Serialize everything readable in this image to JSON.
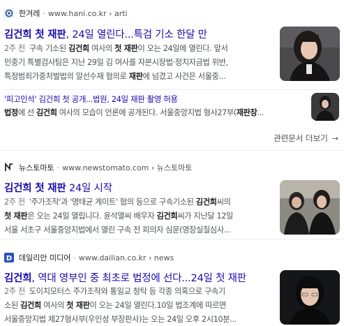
{
  "results": [
    {
      "source": "한겨레",
      "url": "www.hani.co.kr › arti",
      "favicon_color": "#1c4e8c",
      "title_pre": "김건희 첫 재판",
      "title_post": ", 24일 열린다...특검 기소 한달 만",
      "snippet": [
        {
          "date": "2주 전",
          "segs": [
            "구속 기소된 ",
            "**김건희",
            " 여사의 ",
            "**첫 재판",
            "이 오는 24일에 열린다. 앞서"
          ]
        },
        {
          "segs": [
            "민중기 특별검사팀은 지난 29일 김 여사를 자본시장법·정치자금법 위반,"
          ]
        },
        {
          "segs": [
            "특정범죄가중처벌법의 알선수재 혐의로 ",
            "**재판",
            "에 넘겼고 사건은 서울중..."
          ]
        }
      ]
    },
    {
      "source": "뉴스토마토",
      "url": "www.newstomato.com › 뉴스토마토",
      "favicon_color": "#222222",
      "title_pre": "김건희 첫 재판",
      "title_post": " 24일 시작",
      "snippet": [
        {
          "date": "2주 전",
          "segs": [
            "'주가조작'과 '명태균 게이트' 혐의 등으로 구속기소된 ",
            "**김건희",
            "씨의"
          ]
        },
        {
          "segs": [
            "**첫 재판",
            "은 오는 24일 열립니다. 윤석열씨 배우자 ",
            "**김건희",
            "씨가 지난달 12일"
          ]
        },
        {
          "segs": [
            "서울 서초구 서울중앙지법에서 열린 구속 전 피의자 심문(영장실질심사..."
          ]
        }
      ]
    },
    {
      "source": "데일리안 미디어",
      "url": "www.dailian.co.kr › news",
      "favicon_color": "#2a55b8",
      "title_pre": "김건희",
      "title_post": ", 역대 영부인 중 최초로 법정에 선다...24일 첫 재판",
      "snippet": [
        {
          "date": "2주 전",
          "segs": [
            "도이치모터스 주가조작와 통일교 청탁 등 각종 의혹으로 구속기"
          ]
        },
        {
          "segs": [
            "소된 ",
            "**김건희",
            " 여사의 ",
            "**첫 재판",
            "이 오는 24일 열린다.10일 법조계에 따르면"
          ]
        },
        {
          "segs": [
            "서울중앙지법 제27형사부(우인성 부장판사)는 오는 24일 오후 2시10분..."
          ]
        }
      ]
    }
  ],
  "sub_result": {
    "title": "'피고인석' 김건희 첫 공개...법원, 24일 재판 촬영 허용",
    "snippet_segs": [
      "**법정",
      "에 선 ",
      "**김건희",
      " 여사의 모습이 언론에 공개된다. 서울중앙지법 형사27부(",
      "**재판장",
      "..."
    ]
  },
  "more_label": "관련문서 더보기"
}
